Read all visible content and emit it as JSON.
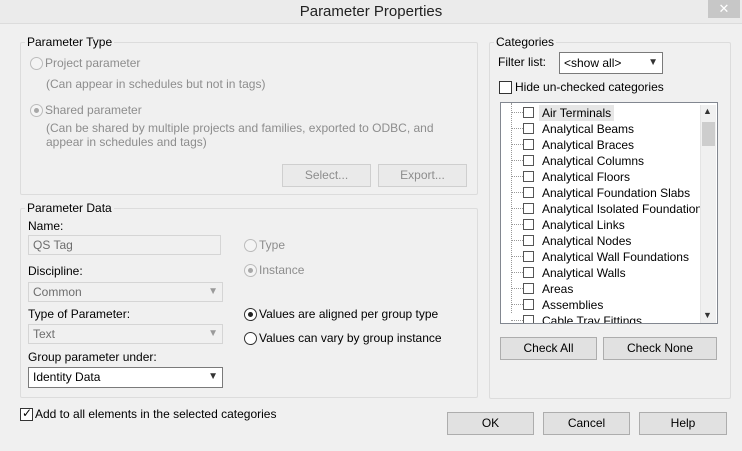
{
  "window": {
    "title": "Parameter Properties",
    "close_glyph": "✕"
  },
  "parameter_type": {
    "legend": "Parameter Type",
    "project_label": "Project parameter",
    "project_note": "(Can appear in schedules but not in tags)",
    "shared_label": "Shared parameter",
    "shared_note_line1": "(Can be shared by multiple projects and families, exported to ODBC, and",
    "shared_note_line2": "appear in schedules and tags)",
    "select_label": "Select...",
    "export_label": "Export..."
  },
  "parameter_data": {
    "legend": "Parameter Data",
    "name_label": "Name:",
    "name_value": "QS Tag",
    "type_label": "Type",
    "instance_label": "Instance",
    "discipline_label": "Discipline:",
    "discipline_value": "Common",
    "type_of_parameter_label": "Type of Parameter:",
    "type_of_parameter_value": "Text",
    "aligned_label": "Values are aligned per group type",
    "vary_label": "Values can vary by group instance",
    "group_under_label": "Group parameter under:",
    "group_under_value": "Identity Data"
  },
  "categories": {
    "legend": "Categories",
    "filter_label": "Filter list:",
    "filter_value": "<show all>",
    "hide_label": "Hide un-checked categories",
    "items": [
      "Air Terminals",
      "Analytical Beams",
      "Analytical Braces",
      "Analytical Columns",
      "Analytical Floors",
      "Analytical Foundation Slabs",
      "Analytical Isolated Foundations",
      "Analytical Links",
      "Analytical Nodes",
      "Analytical Wall Foundations",
      "Analytical Walls",
      "Areas",
      "Assemblies",
      "Cable Tray Fittings"
    ],
    "check_all_label": "Check All",
    "check_none_label": "Check None"
  },
  "footer": {
    "add_all_label": "Add to all elements in the selected categories",
    "ok_label": "OK",
    "cancel_label": "Cancel",
    "help_label": "Help"
  }
}
